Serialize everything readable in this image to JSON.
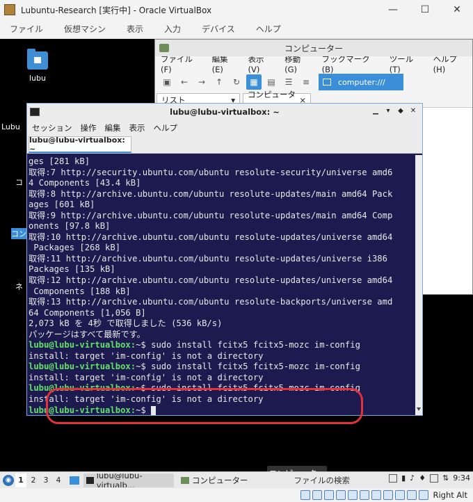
{
  "window": {
    "title": "Lubuntu-Research [実行中] - Oracle VirtualBox",
    "minimize": "—",
    "maximize": "☐",
    "close": "✕"
  },
  "vb_menu": [
    "ファイル",
    "仮想マシン",
    "表示",
    "入力",
    "デバイス",
    "ヘルプ"
  ],
  "desktop": {
    "icons": [
      {
        "label": "lubu"
      },
      {
        "label": "Lubu"
      },
      {
        "label": "コ"
      },
      {
        "label": "コン"
      },
      {
        "label": "ネ"
      }
    ]
  },
  "file_manager": {
    "title": "コンピューター",
    "menu": [
      "ファイル(F)",
      "編集(E)",
      "表示(V)",
      "移動(G)",
      "ブックマーク(B)",
      "ツール(T)",
      "ヘルプ(H)"
    ],
    "path": "computer:///",
    "side_label": "リスト",
    "tab_label": "コンピューター",
    "tab_close": "×"
  },
  "terminal": {
    "title": "lubu@lubu-virtualbox: ~",
    "menu": [
      "セッション",
      "操作",
      "編集",
      "表示",
      "ヘルプ"
    ],
    "tab": "lubu@lubu-virtualbox: ~",
    "lines": [
      "ges [281 kB]",
      "取得:7 http://security.ubuntu.com/ubuntu resolute-security/universe amd6",
      "4 Components [43.4 kB]",
      "取得:8 http://archive.ubuntu.com/ubuntu resolute-updates/main amd64 Pack",
      "ages [601 kB]",
      "取得:9 http://archive.ubuntu.com/ubuntu resolute-updates/main amd64 Comp",
      "onents [97.8 kB]",
      "取得:10 http://archive.ubuntu.com/ubuntu resolute-updates/universe amd64",
      " Packages [268 kB]",
      "取得:11 http://archive.ubuntu.com/ubuntu resolute-updates/universe i386",
      "Packages [135 kB]",
      "取得:12 http://archive.ubuntu.com/ubuntu resolute-updates/universe amd64",
      " Components [188 kB]",
      "取得:13 http://archive.ubuntu.com/ubuntu resolute-backports/universe amd",
      "64 Components [1,056 B]",
      "2,073 kB を 4秒 で取得しました (536 kB/s)",
      "パッケージはすべて最新です。"
    ],
    "prompt": "lubu@lubu-virtualbox:",
    "commands": [
      {
        "cmd": "~$ sudo install fcitx5 fcitx5-mozc im-config",
        "out": "install: target 'im-config' is not a directory"
      },
      {
        "cmd": "~$ sudo install fcitx5 fcitx5-mozc im-config",
        "out": "install: target 'im-config' is not a directory"
      },
      {
        "cmd": "~$ sudo install fcitx5 fcitx5-mozc im-config",
        "out": "install: target 'im-config' is not a directory"
      }
    ],
    "final_prompt": "~$ "
  },
  "tooltip": "コンピューター",
  "taskbar": {
    "workspaces": [
      "1",
      "2",
      "3",
      "4"
    ],
    "tasks": [
      "lubu@lubu-virtualb...",
      "コンピューター"
    ],
    "search": "ファイルの検索",
    "clock": "9:34"
  },
  "statusbar": {
    "host_key": "Right Alt"
  }
}
